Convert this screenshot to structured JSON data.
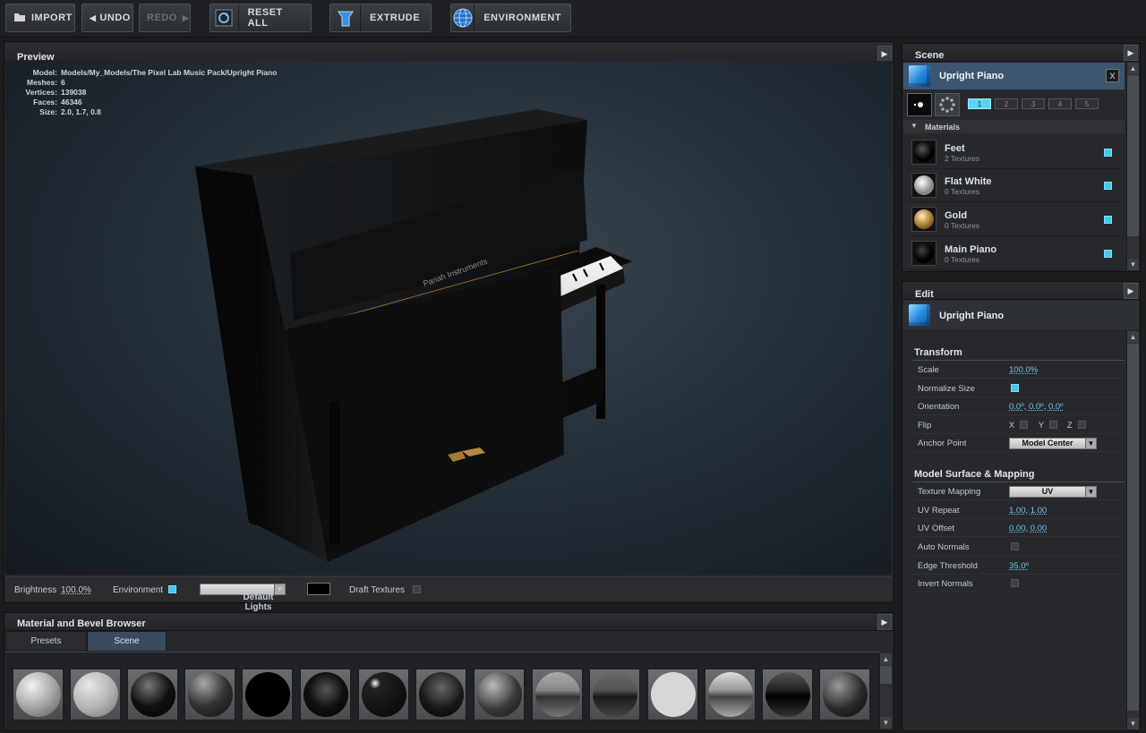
{
  "toolbar": {
    "import": "IMPORT",
    "undo": "UNDO",
    "redo": "REDO",
    "reset_all": "RESET ALL",
    "extrude": "EXTRUDE",
    "environment": "ENVIRONMENT"
  },
  "preview": {
    "title": "Preview",
    "info": {
      "model_label": "Model:",
      "model_value": "Models/My_Models/The Pixel Lab Music Pack/Upright Piano",
      "meshes_label": "Meshes:",
      "meshes_value": "6",
      "vertices_label": "Vertices:",
      "vertices_value": "139038",
      "faces_label": "Faces:",
      "faces_value": "46346",
      "size_label": "Size:",
      "size_value": "2.0, 1.7, 0.8"
    },
    "piano_brand": "Pariah Instruments",
    "bottom": {
      "brightness_label": "Brightness",
      "brightness_value": "100.0%",
      "environment_label": "Environment",
      "environment_checked": true,
      "lights_select": "Default Lights",
      "draft_textures_label": "Draft Textures",
      "draft_textures_checked": false
    }
  },
  "material_browser": {
    "title": "Material and Bevel Browser",
    "tabs": [
      "Presets",
      "Scene"
    ],
    "active_tab": "Scene"
  },
  "scene": {
    "title": "Scene",
    "selected": "Upright Piano",
    "close": "X",
    "layers": [
      "1",
      "2",
      "3",
      "4",
      "5"
    ],
    "active_layer": "1",
    "materials_label": "Materials",
    "materials": [
      {
        "name": "Feet",
        "textures": "2 Textures"
      },
      {
        "name": "Flat White",
        "textures": "0 Textures"
      },
      {
        "name": "Gold",
        "textures": "0 Textures"
      },
      {
        "name": "Main Piano",
        "textures": "0 Textures"
      }
    ]
  },
  "edit": {
    "title": "Edit",
    "object": "Upright Piano",
    "transform_title": "Transform",
    "scale_label": "Scale",
    "scale_value": "100.0%",
    "normalize_label": "Normalize Size",
    "orientation_label": "Orientation",
    "orientation_x": "0.0º",
    "orientation_y": "0.0º",
    "orientation_z": "0.0º",
    "flip_label": "Flip",
    "flip_x": "X",
    "flip_y": "Y",
    "flip_z": "Z",
    "anchor_label": "Anchor Point",
    "anchor_value": "Model Center",
    "surface_title": "Model Surface & Mapping",
    "texture_mapping_label": "Texture Mapping",
    "texture_mapping_value": "UV",
    "uv_repeat_label": "UV Repeat",
    "uv_repeat_u": "1.00",
    "uv_repeat_v": "1.00",
    "uv_offset_label": "UV Offset",
    "uv_offset_u": "0.00",
    "uv_offset_v": "0.00",
    "auto_normals_label": "Auto Normals",
    "edge_threshold_label": "Edge Threshold",
    "edge_threshold_value": "35.0º",
    "invert_normals_label": "Invert Normals",
    "separator": ","
  },
  "colors": {
    "accent": "#45c9ee",
    "selection": "#3c5670"
  }
}
